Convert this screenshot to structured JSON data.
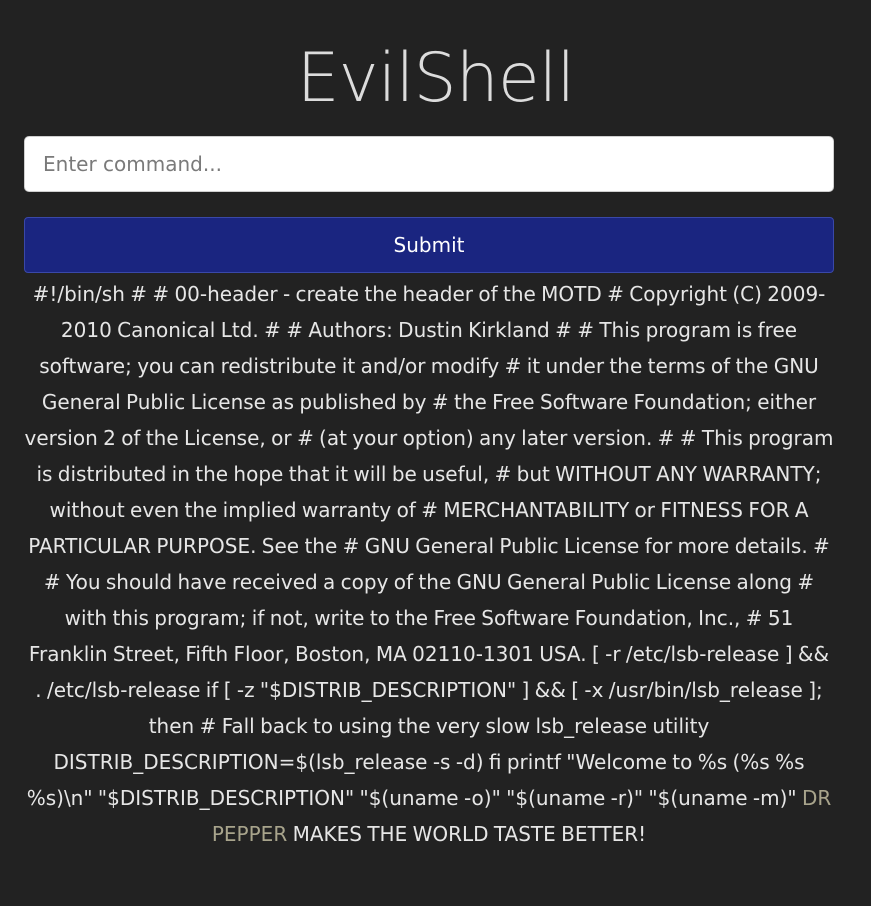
{
  "app": {
    "title": "EvilShell"
  },
  "form": {
    "command_placeholder": "Enter command...",
    "command_value": "",
    "submit_label": "Submit"
  },
  "output": {
    "text": "#!/bin/sh # # 00-header - create the header of the MOTD # Copyright (C) 2009-2010 Canonical Ltd. # # Authors: Dustin Kirkland # # This program is free software; you can redistribute it and/or modify # it under the terms of the GNU General Public License as published by # the Free Software Foundation; either version 2 of the License, or # (at your option) any later version. # # This program is distributed in the hope that it will be useful, # but WITHOUT ANY WARRANTY; without even the implied warranty of # MERCHANTABILITY or FITNESS FOR A PARTICULAR PURPOSE. See the # GNU General Public License for more details. # # You should have received a copy of the GNU General Public License along # with this program; if not, write to the Free Software Foundation, Inc., # 51 Franklin Street, Fifth Floor, Boston, MA 02110-1301 USA. [ -r /etc/lsb-release ] && . /etc/lsb-release if [ -z \"$DISTRIB_DESCRIPTION\" ] && [ -x /usr/bin/lsb_release ]; then # Fall back to using the very slow lsb_release utility DISTRIB_DESCRIPTION=$(lsb_release -s -d) fi printf \"Welcome to %s (%s %s %s)\\n\" \"$DISTRIB_DESCRIPTION\" \"$(uname -o)\" \"$(uname -r)\" \"$(uname -m)\"",
    "accent_text": "DR PEPPER",
    "tail_text": "MAKES THE WORLD TASTE BETTER!"
  },
  "colors": {
    "background": "#222222",
    "button": "#1a2580",
    "accent": "#a8a48c"
  }
}
